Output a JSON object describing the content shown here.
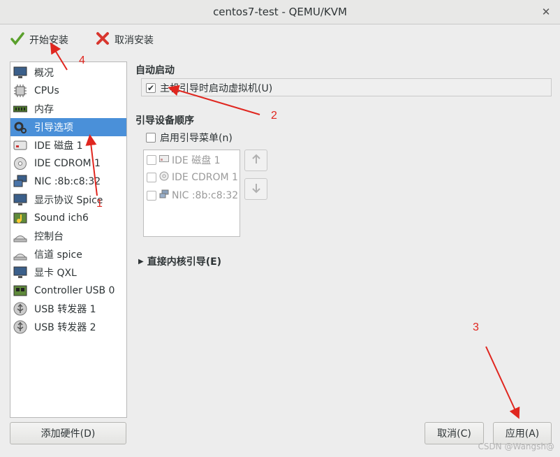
{
  "window": {
    "title": "centos7-test - QEMU/KVM"
  },
  "toolbar": {
    "begin_install": "开始安装",
    "cancel_install": "取消安装"
  },
  "sidebar": {
    "items": [
      {
        "label": "概况",
        "icon": "monitor-icon"
      },
      {
        "label": "CPUs",
        "icon": "cpu-icon"
      },
      {
        "label": "内存",
        "icon": "memory-icon"
      },
      {
        "label": "引导选项",
        "icon": "boot-options-icon",
        "selected": true
      },
      {
        "label": "IDE 磁盘 1",
        "icon": "disk-icon"
      },
      {
        "label": "IDE CDROM 1",
        "icon": "cdrom-icon"
      },
      {
        "label": "NIC :8b:c8:32",
        "icon": "network-icon"
      },
      {
        "label": "显示协议 Spice",
        "icon": "display-icon"
      },
      {
        "label": "Sound ich6",
        "icon": "sound-icon"
      },
      {
        "label": "控制台",
        "icon": "console-icon"
      },
      {
        "label": "信道 spice",
        "icon": "channel-icon"
      },
      {
        "label": "显卡 QXL",
        "icon": "video-card-icon"
      },
      {
        "label": "Controller USB 0",
        "icon": "controller-icon"
      },
      {
        "label": "USB 转发器 1",
        "icon": "usb-icon"
      },
      {
        "label": "USB 转发器 2",
        "icon": "usb-icon"
      }
    ],
    "add_hardware": "添加硬件(D)"
  },
  "autostart": {
    "title": "自动启动",
    "checkbox_label": "主机引导时启动虚拟机(U)",
    "checked": true
  },
  "boot_order": {
    "title": "引导设备顺序",
    "menu_label": "启用引导菜单(n)",
    "menu_checked": false,
    "devices": [
      {
        "label": "IDE 磁盘 1",
        "icon": "disk-icon"
      },
      {
        "label": "IDE CDROM 1",
        "icon": "cdrom-icon"
      },
      {
        "label": "NIC :8b:c8:32",
        "icon": "network-icon"
      }
    ]
  },
  "kernel_boot": {
    "label": "直接内核引导(E)"
  },
  "footer": {
    "cancel": "取消(C)",
    "apply": "应用(A)"
  },
  "annotations": {
    "a1": "1",
    "a2": "2",
    "a3": "3",
    "a4": "4",
    "color": "#e0261f"
  },
  "watermark": "CSDN @Wangsh@",
  "colors": {
    "selection": "#4a90d9",
    "background": "#ededed"
  }
}
